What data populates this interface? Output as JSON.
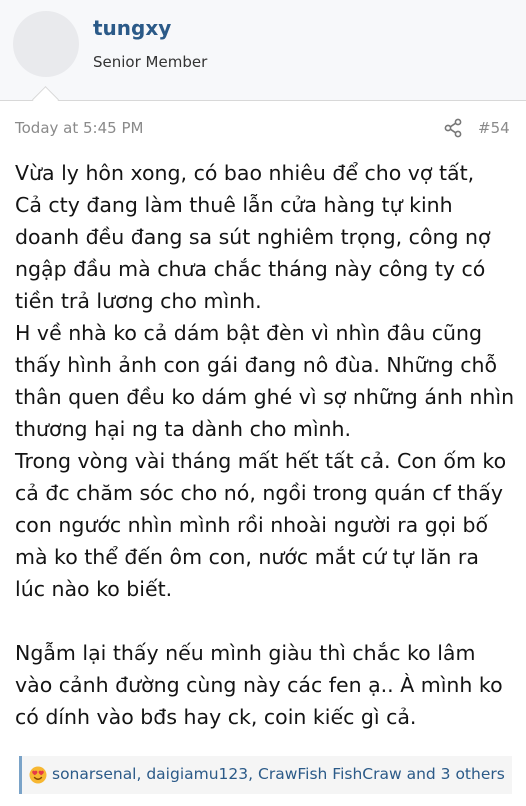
{
  "post": {
    "author": "tungxy",
    "author_title": "Senior Member",
    "timestamp": "Today at 5:45 PM",
    "post_number": "#54",
    "share_icon": "share-icon",
    "paragraphs": [
      "Vừa ly hôn xong, có bao nhiêu để cho vợ tất,",
      "Cả cty đang làm thuê lẫn cửa hàng tự kinh doanh đều đang sa sút nghiêm trọng, công nợ ngập đầu mà chưa chắc tháng này công ty có tiền trả lương cho mình.",
      "H về nhà ko cả dám bật đèn vì nhìn đâu cũng thấy hình ảnh con gái đang nô đùa. Những chỗ thân quen đều ko dám ghé vì sợ những ánh nhìn thương hại ng ta dành cho mình.",
      "Trong vòng vài tháng mất hết tất cả. Con ốm ko cả đc chăm sóc cho nó, ngồi trong quán cf thấy con ngước nhìn mình rồi nhoài người ra gọi bố mà ko thể đến ôm con, nước mắt cứ tự lăn ra lúc nào ko biết.",
      "Ngẫm lại thấy nếu mình giàu thì chắc ko lâm vào cảnh đường cùng này các fen ạ.. À mình ko có dính vào bđs hay ck, coin kiếc gì cả."
    ]
  },
  "reactions": {
    "icon": "love-reaction-icon",
    "text": "sonarsenal, daigiamu123, CrawFish FishCraw and 3 others"
  }
}
